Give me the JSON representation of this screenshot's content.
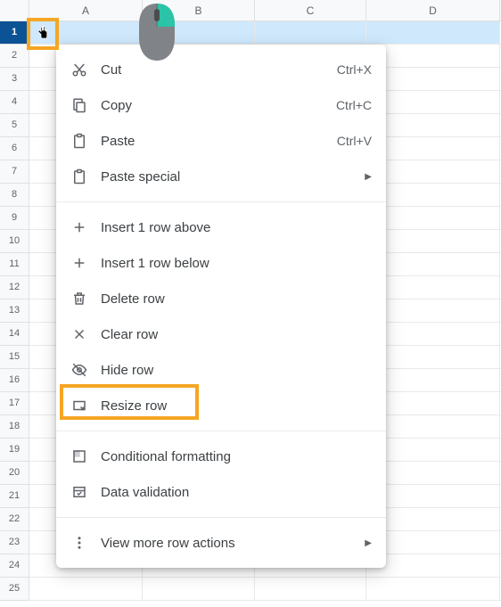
{
  "columns": [
    "A",
    "B",
    "C",
    "D"
  ],
  "rows": [
    "1",
    "2",
    "3",
    "4",
    "5",
    "6",
    "7",
    "8",
    "9",
    "10",
    "11",
    "12",
    "13",
    "14",
    "15",
    "16",
    "17",
    "18",
    "19",
    "20",
    "21",
    "22",
    "23",
    "24",
    "25"
  ],
  "selected_row_index": 0,
  "menu": {
    "cut": {
      "label": "Cut",
      "shortcut": "Ctrl+X"
    },
    "copy": {
      "label": "Copy",
      "shortcut": "Ctrl+C"
    },
    "paste": {
      "label": "Paste",
      "shortcut": "Ctrl+V"
    },
    "paste_special": {
      "label": "Paste special"
    },
    "insert_above": {
      "label": "Insert 1 row above"
    },
    "insert_below": {
      "label": "Insert 1 row below"
    },
    "delete_row": {
      "label": "Delete row"
    },
    "clear_row": {
      "label": "Clear row"
    },
    "hide_row": {
      "label": "Hide row"
    },
    "resize_row": {
      "label": "Resize row"
    },
    "cond_fmt": {
      "label": "Conditional formatting"
    },
    "data_valid": {
      "label": "Data validation"
    },
    "more": {
      "label": "View more row actions"
    }
  },
  "annotation": {
    "highlight_color": "#f5a623"
  }
}
